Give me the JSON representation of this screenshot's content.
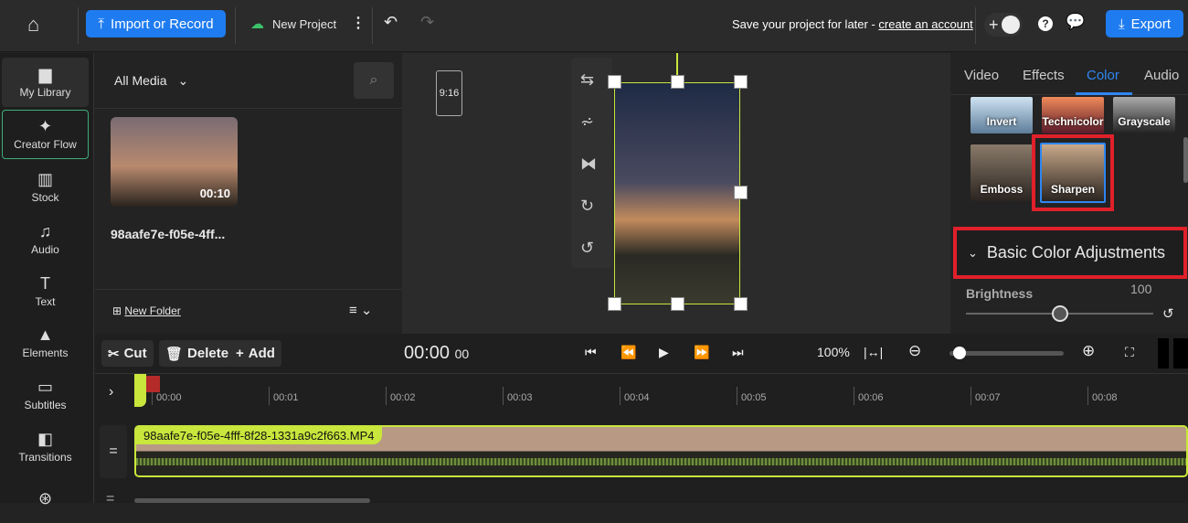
{
  "topbar": {
    "import_label": "Import or Record",
    "project_name": "New Project",
    "save_prompt": "Save your project for later - ",
    "create_account": "create an account",
    "export_label": "Export",
    "plus": "+"
  },
  "sidebar": {
    "items": [
      {
        "label": "My Library",
        "icon": "folder-icon"
      },
      {
        "label": "Creator Flow",
        "icon": "sparkle-icon"
      },
      {
        "label": "Stock",
        "icon": "books-icon"
      },
      {
        "label": "Audio",
        "icon": "music-icon"
      },
      {
        "label": "Text",
        "icon": "text-icon"
      },
      {
        "label": "Elements",
        "icon": "shapes-icon"
      },
      {
        "label": "Subtitles",
        "icon": "subtitles-icon"
      },
      {
        "label": "Transitions",
        "icon": "transitions-icon"
      },
      {
        "label": "",
        "icon": "filters-icon"
      }
    ]
  },
  "media": {
    "filter": "All Media",
    "item": {
      "name": "98aafe7e-f05e-4ff...",
      "duration": "00:10"
    },
    "new_folder": "New Folder"
  },
  "preview": {
    "aspect": "9:16"
  },
  "right": {
    "tabs": [
      "Video",
      "Effects",
      "Color",
      "Audio"
    ],
    "active_tab": "Color",
    "filters": [
      "Invert",
      "Technicolor",
      "Grayscale",
      "Emboss",
      "Sharpen"
    ],
    "selected_filter": "Sharpen",
    "section": "Basic Color Adjustments",
    "brightness_label": "Brightness",
    "brightness_value": "100",
    "brightness_fraction": 0.5
  },
  "timeline": {
    "cut": "Cut",
    "delete": "Delete",
    "add": "Add",
    "time": "00:00",
    "frames": "00",
    "zoom": "100%",
    "zoom_fraction": 0.05,
    "ticks": [
      "00:00",
      "00:01",
      "00:02",
      "00:03",
      "00:04",
      "00:05",
      "00:06",
      "00:07",
      "00:08"
    ],
    "clip_name": "98aafe7e-f05e-4fff-8f28-1331a9c2f663.MP4"
  },
  "colors": {
    "accent": "#1f7cf0",
    "clip": "#c8e63c",
    "highlight": "#e0202a"
  }
}
